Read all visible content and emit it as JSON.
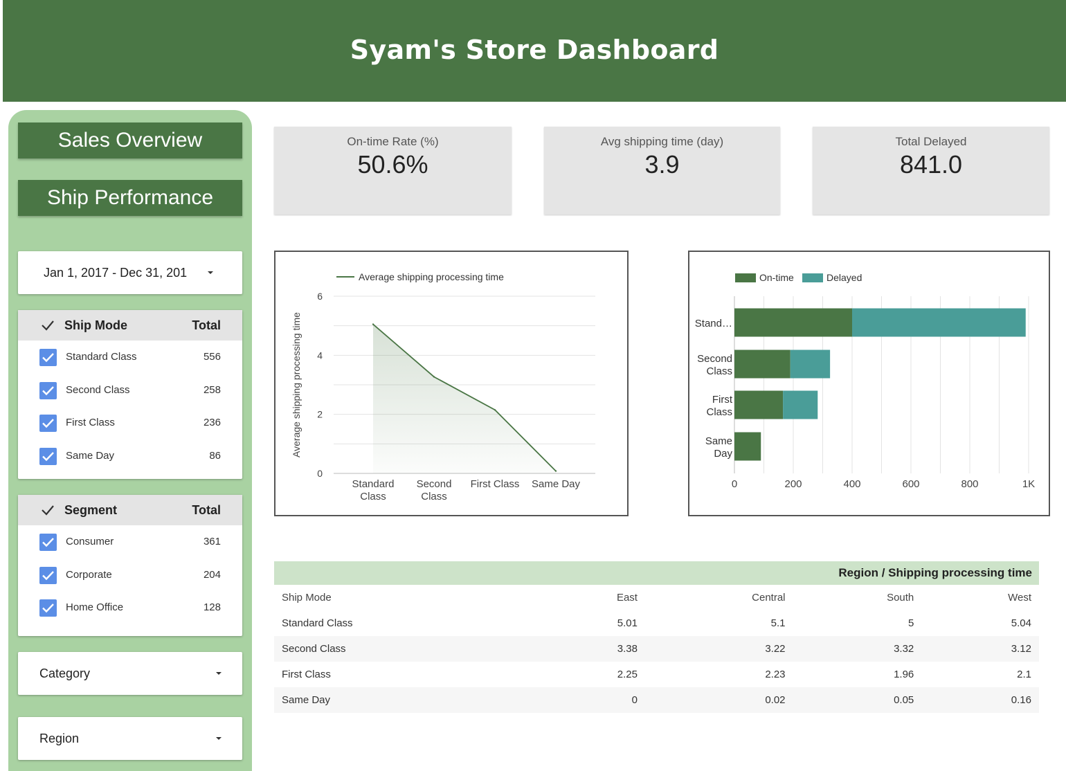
{
  "header": {
    "title": "Syam's Store Dashboard"
  },
  "sidebar": {
    "nav": [
      "Sales Overview",
      "Ship Performance"
    ],
    "date_range": "Jan 1, 2017 - Dec 31, 201",
    "ship_mode": {
      "title": "Ship Mode",
      "total_label": "Total",
      "items": [
        {
          "label": "Standard Class",
          "count": "556"
        },
        {
          "label": "Second Class",
          "count": "258"
        },
        {
          "label": "First Class",
          "count": "236"
        },
        {
          "label": "Same Day",
          "count": "86"
        }
      ]
    },
    "segment": {
      "title": "Segment",
      "total_label": "Total",
      "items": [
        {
          "label": "Consumer",
          "count": "361"
        },
        {
          "label": "Corporate",
          "count": "204"
        },
        {
          "label": "Home Office",
          "count": "128"
        }
      ]
    },
    "category_label": "Category",
    "region_label": "Region"
  },
  "kpis": [
    {
      "label": "On-time Rate (%)",
      "value": "50.6%"
    },
    {
      "label": "Avg shipping time (day)",
      "value": "3.9"
    },
    {
      "label": "Total Delayed",
      "value": "841.0"
    }
  ],
  "colors": {
    "brand": "#4a7645",
    "on_time": "#4a7645",
    "delayed": "#4a9d98",
    "table_header": "#cde3c9"
  },
  "chart_data": [
    {
      "type": "area",
      "legend": [
        "Average shipping processing time"
      ],
      "ylabel": "Average shipping processing time",
      "categories": [
        "Standard Class",
        "Second Class",
        "First Class",
        "Same Day"
      ],
      "category_lines": [
        [
          "Standard",
          "Class"
        ],
        [
          "Second",
          "Class"
        ],
        [
          "First Class"
        ],
        [
          "Same Day"
        ]
      ],
      "values": [
        5.05,
        3.27,
        2.15,
        0.08
      ],
      "ylim": [
        0,
        6
      ],
      "yticks": [
        0,
        2,
        4,
        6
      ],
      "grid": true
    },
    {
      "type": "bar",
      "orientation": "horizontal",
      "stacked": true,
      "categories": [
        "Stand...",
        "Second Class",
        "First Class",
        "Same Day"
      ],
      "category_lines": [
        [
          "Stand…"
        ],
        [
          "Second",
          "Class"
        ],
        [
          "First",
          "Class"
        ],
        [
          "Same",
          "Day"
        ]
      ],
      "series": [
        {
          "name": "On-time",
          "values": [
            400,
            190,
            165,
            90
          ]
        },
        {
          "name": "Delayed",
          "values": [
            590,
            135,
            118,
            0
          ]
        }
      ],
      "xlim": [
        0,
        1000
      ],
      "xticks": [
        "0",
        "200",
        "400",
        "600",
        "800",
        "1K"
      ],
      "legend_position": "top-left",
      "grid": true
    }
  ],
  "table": {
    "title": "Region / Shipping processing time",
    "columns": [
      "Ship Mode",
      "East",
      "Central",
      "South",
      "West"
    ],
    "rows": [
      [
        "Standard Class",
        "5.01",
        "5.1",
        "5",
        "5.04"
      ],
      [
        "Second Class",
        "3.38",
        "3.22",
        "3.32",
        "3.12"
      ],
      [
        "First Class",
        "2.25",
        "2.23",
        "1.96",
        "2.1"
      ],
      [
        "Same Day",
        "0",
        "0.02",
        "0.05",
        "0.16"
      ]
    ]
  }
}
